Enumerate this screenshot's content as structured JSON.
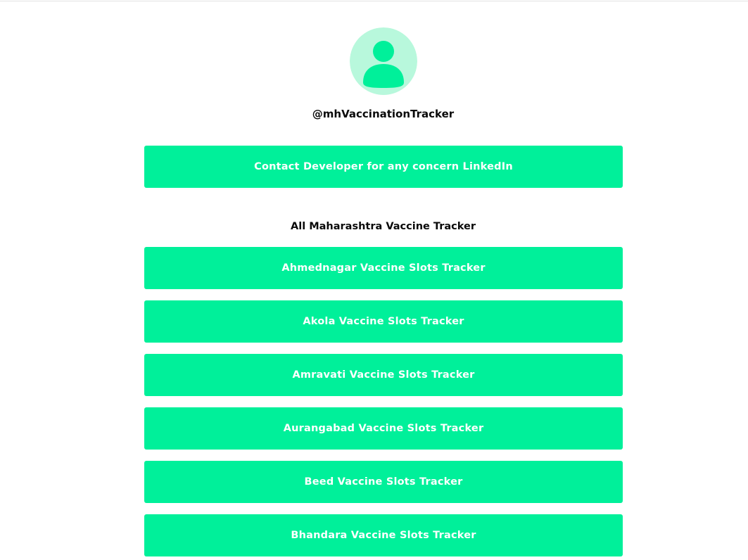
{
  "profile": {
    "handle": "@mhVaccinationTracker",
    "avatar_icon": "person-icon",
    "avatar_bg": "#b8f8dc",
    "avatar_fg": "#00f09a"
  },
  "contact_link": {
    "label": "Contact Developer for any concern LinkedIn"
  },
  "section": {
    "title": "All Maharashtra Vaccine Tracker"
  },
  "links": [
    {
      "label": "Ahmednagar Vaccine Slots Tracker"
    },
    {
      "label": "Akola Vaccine Slots Tracker"
    },
    {
      "label": "Amravati Vaccine Slots Tracker"
    },
    {
      "label": "Aurangabad Vaccine Slots Tracker"
    },
    {
      "label": "Beed Vaccine Slots Tracker"
    },
    {
      "label": "Bhandara Vaccine Slots Tracker"
    }
  ],
  "colors": {
    "button_bg": "#00f09a",
    "button_text": "#ffffff",
    "text": "#0a0a0a"
  }
}
